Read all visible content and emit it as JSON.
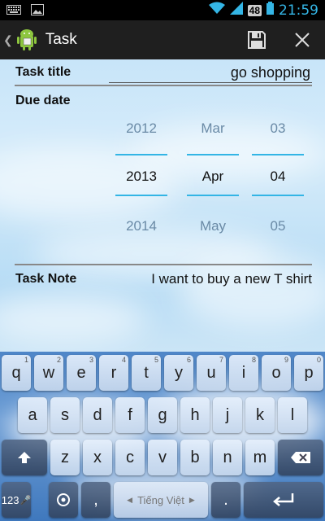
{
  "status_bar": {
    "time": "21:59",
    "battery": "48"
  },
  "action_bar": {
    "title": "Task",
    "save_icon": "save-icon",
    "close_icon": "close-icon"
  },
  "form": {
    "task_title_label": "Task title",
    "task_title_value": "go shopping",
    "due_date_label": "Due date",
    "picker": {
      "year": {
        "prev": "2012",
        "current": "2013",
        "next": "2014"
      },
      "month": {
        "prev": "Mar",
        "current": "Apr",
        "next": "May"
      },
      "day": {
        "prev": "03",
        "current": "04",
        "next": "05"
      }
    },
    "task_note_label": "Task Note",
    "task_note_value": "I want to buy a new T shirt"
  },
  "keyboard": {
    "row1": [
      {
        "k": "q",
        "h": "1"
      },
      {
        "k": "w",
        "h": "2"
      },
      {
        "k": "e",
        "h": "3"
      },
      {
        "k": "r",
        "h": "4"
      },
      {
        "k": "t",
        "h": "5"
      },
      {
        "k": "y",
        "h": "6"
      },
      {
        "k": "u",
        "h": "7"
      },
      {
        "k": "i",
        "h": "8"
      },
      {
        "k": "o",
        "h": "9"
      },
      {
        "k": "p",
        "h": "0"
      }
    ],
    "row2": [
      "a",
      "s",
      "d",
      "f",
      "g",
      "h",
      "j",
      "k",
      "l"
    ],
    "row3": [
      "z",
      "x",
      "c",
      "v",
      "b",
      "n",
      "m"
    ],
    "mode_label": "123",
    "space_label": "Tiếng Việt",
    "comma": ",",
    "period": "."
  }
}
